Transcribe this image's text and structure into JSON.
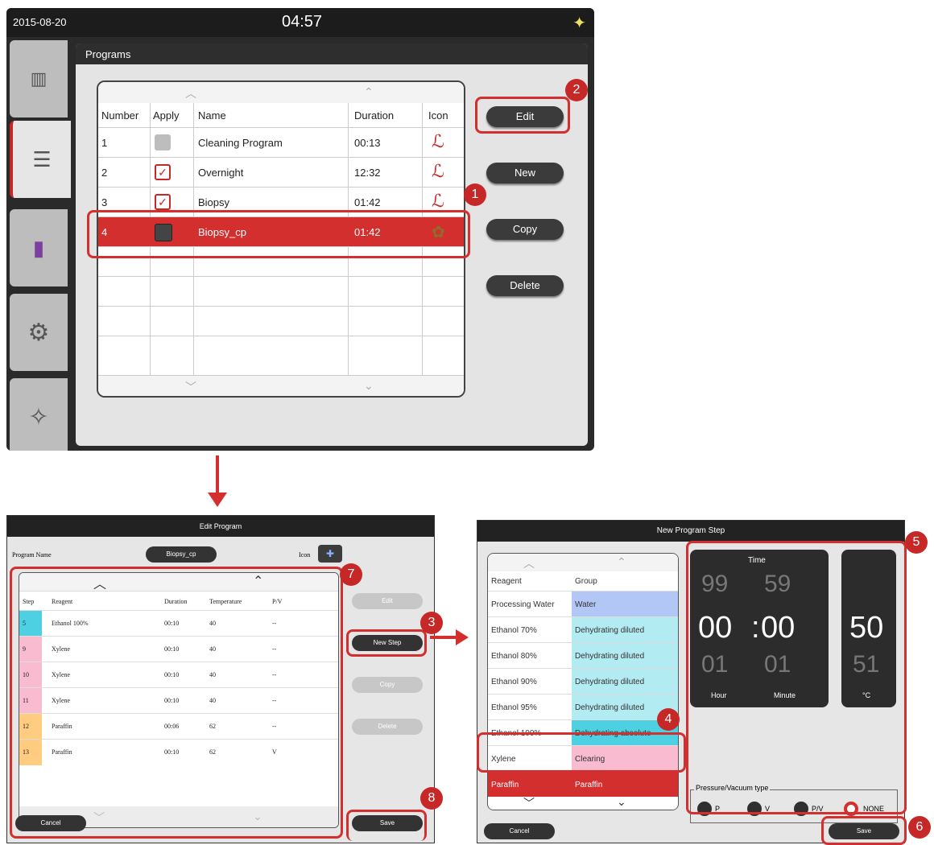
{
  "programs_screen": {
    "date": "2015-08-20",
    "time": "04:57",
    "panel_title": "Programs",
    "columns": [
      "Number",
      "Apply",
      "Name",
      "Duration",
      "Icon"
    ],
    "rows": [
      {
        "number": "1",
        "apply": "off",
        "name": "Cleaning Program",
        "duration": "00:13",
        "icon": "ℒ"
      },
      {
        "number": "2",
        "apply": "on",
        "name": "Overnight",
        "duration": "12:32",
        "icon": "ℒ"
      },
      {
        "number": "3",
        "apply": "on",
        "name": "Biopsy",
        "duration": "01:42",
        "icon": "ℒ"
      },
      {
        "number": "4",
        "apply": "dark",
        "name": "Biopsy_cp",
        "duration": "01:42",
        "icon": "✿"
      }
    ],
    "buttons": {
      "edit": "Edit",
      "new": "New",
      "copy": "Copy",
      "delete": "Delete"
    }
  },
  "edit_program": {
    "title": "Edit Program",
    "program_name_label": "Program Name",
    "program_name_value": "Biopsy_cp",
    "icon_label": "Icon",
    "columns": [
      "Step",
      "Reagent",
      "Duration",
      "Temperature",
      "P/V"
    ],
    "rows": [
      {
        "step": "5",
        "reagent": "Ethanol 100%",
        "duration": "00:10",
        "temperature": "40",
        "pv": "--",
        "color": "#4dd0e1"
      },
      {
        "step": "9",
        "reagent": "Xylene",
        "duration": "00:10",
        "temperature": "40",
        "pv": "--",
        "color": "#f8bbd0"
      },
      {
        "step": "10",
        "reagent": "Xylene",
        "duration": "00:10",
        "temperature": "40",
        "pv": "--",
        "color": "#f8bbd0"
      },
      {
        "step": "11",
        "reagent": "Xylene",
        "duration": "00:10",
        "temperature": "40",
        "pv": "--",
        "color": "#f8bbd0"
      },
      {
        "step": "12",
        "reagent": "Paraffin",
        "duration": "00:06",
        "temperature": "62",
        "pv": "--",
        "color": "#ffcc80"
      },
      {
        "step": "13",
        "reagent": "Paraffin",
        "duration": "00:10",
        "temperature": "62",
        "pv": "V",
        "color": "#ffcc80"
      }
    ],
    "buttons": {
      "edit": "Edit",
      "new_step": "New Step",
      "copy": "Copy",
      "delete": "Delete",
      "cancel": "Cancel",
      "save": "Save"
    }
  },
  "new_step": {
    "title": "New Program Step",
    "columns": [
      "Reagent",
      "Group"
    ],
    "rows": [
      {
        "reagent": "Processing Water",
        "group": "Water",
        "color": "#b3c7f7"
      },
      {
        "reagent": "Ethanol 70%",
        "group": "Dehydrating diluted",
        "color": "#b2ebf2"
      },
      {
        "reagent": "Ethanol 80%",
        "group": "Dehydrating diluted",
        "color": "#b2ebf2"
      },
      {
        "reagent": "Ethanol 90%",
        "group": "Dehydrating diluted",
        "color": "#b2ebf2"
      },
      {
        "reagent": "Ethanol 95%",
        "group": "Dehydrating diluted",
        "color": "#b2ebf2"
      },
      {
        "reagent": "Ethanol 100%",
        "group": "Dehydrating absolute",
        "color": "#4dd0e1"
      },
      {
        "reagent": "Xylene",
        "group": "Clearing",
        "color": "#f8bbd0"
      },
      {
        "reagent": "Paraffin",
        "group": "Paraffin",
        "color": "#d32f2f"
      }
    ],
    "time_label": "Time",
    "hour_above": "99",
    "minute_above": "59",
    "hour": "00",
    "minute": "00",
    "hour_below": "01",
    "minute_below": "01",
    "hour_label": "Hour",
    "minute_label": "Minute",
    "temp": "50",
    "temp_below": "51",
    "temp_unit": "°C",
    "pv_label": "Pressure/Vacuum type",
    "pv_options": [
      "P",
      "V",
      "P/V",
      "NONE"
    ],
    "buttons": {
      "cancel": "Cancel",
      "save": "Save"
    }
  },
  "callouts": [
    "1",
    "2",
    "3",
    "4",
    "5",
    "6",
    "7",
    "8"
  ],
  "colors": {
    "accent": "#d32f2f"
  }
}
